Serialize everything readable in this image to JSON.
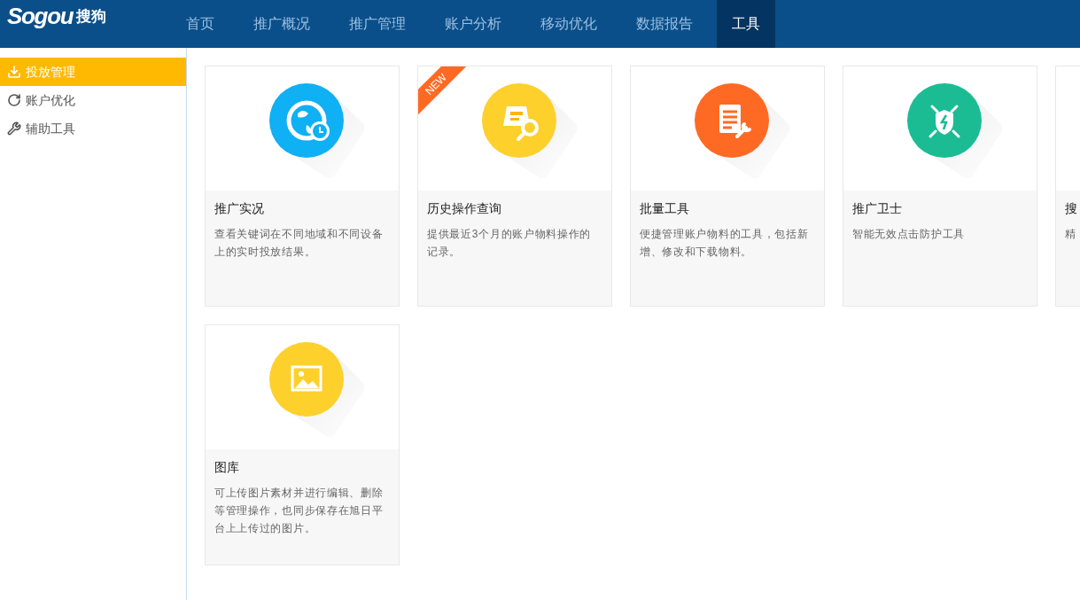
{
  "logo": {
    "latin": "Sogou",
    "chinese": "搜狗"
  },
  "nav": [
    {
      "label": "首页",
      "selected": false
    },
    {
      "label": "推广概况",
      "selected": false
    },
    {
      "label": "推广管理",
      "selected": false
    },
    {
      "label": "账户分析",
      "selected": false
    },
    {
      "label": "移动优化",
      "selected": false
    },
    {
      "label": "数据报告",
      "selected": false
    },
    {
      "label": "工具",
      "selected": true
    }
  ],
  "sidebar": {
    "items": [
      {
        "label": "投放管理",
        "kind": "download",
        "selected": true
      },
      {
        "label": "账户优化",
        "kind": "refresh",
        "selected": false
      },
      {
        "label": "辅助工具",
        "kind": "wrench",
        "selected": false
      }
    ]
  },
  "cards": [
    {
      "title": "推广实况",
      "description": "查看关键词在不同地域和不同设备上的实时投放结果。",
      "kind": "globe",
      "color": "#0fb0f4"
    },
    {
      "title": "历史操作查询",
      "description": "提供最近3个月的账户物料操作的记录。",
      "kind": "archive",
      "color": "#fdd02c",
      "badge": "NEW"
    },
    {
      "title": "批量工具",
      "description": "便捷管理账户物料的工具，包括新增、修改和下载物料。",
      "kind": "document",
      "color": "#fe6a24"
    },
    {
      "title": "推广卫士",
      "description": "智能无效点击防护工具",
      "kind": "shield",
      "color": "#1bbc94"
    },
    {
      "title": "搜",
      "description": "精",
      "kind": "none"
    },
    {
      "title": "图库",
      "description": "可上传图片素材并进行编辑、删除等管理操作，也同步保存在旭日平台上上传过的图片。",
      "kind": "image",
      "color": "#fdd02c"
    }
  ]
}
